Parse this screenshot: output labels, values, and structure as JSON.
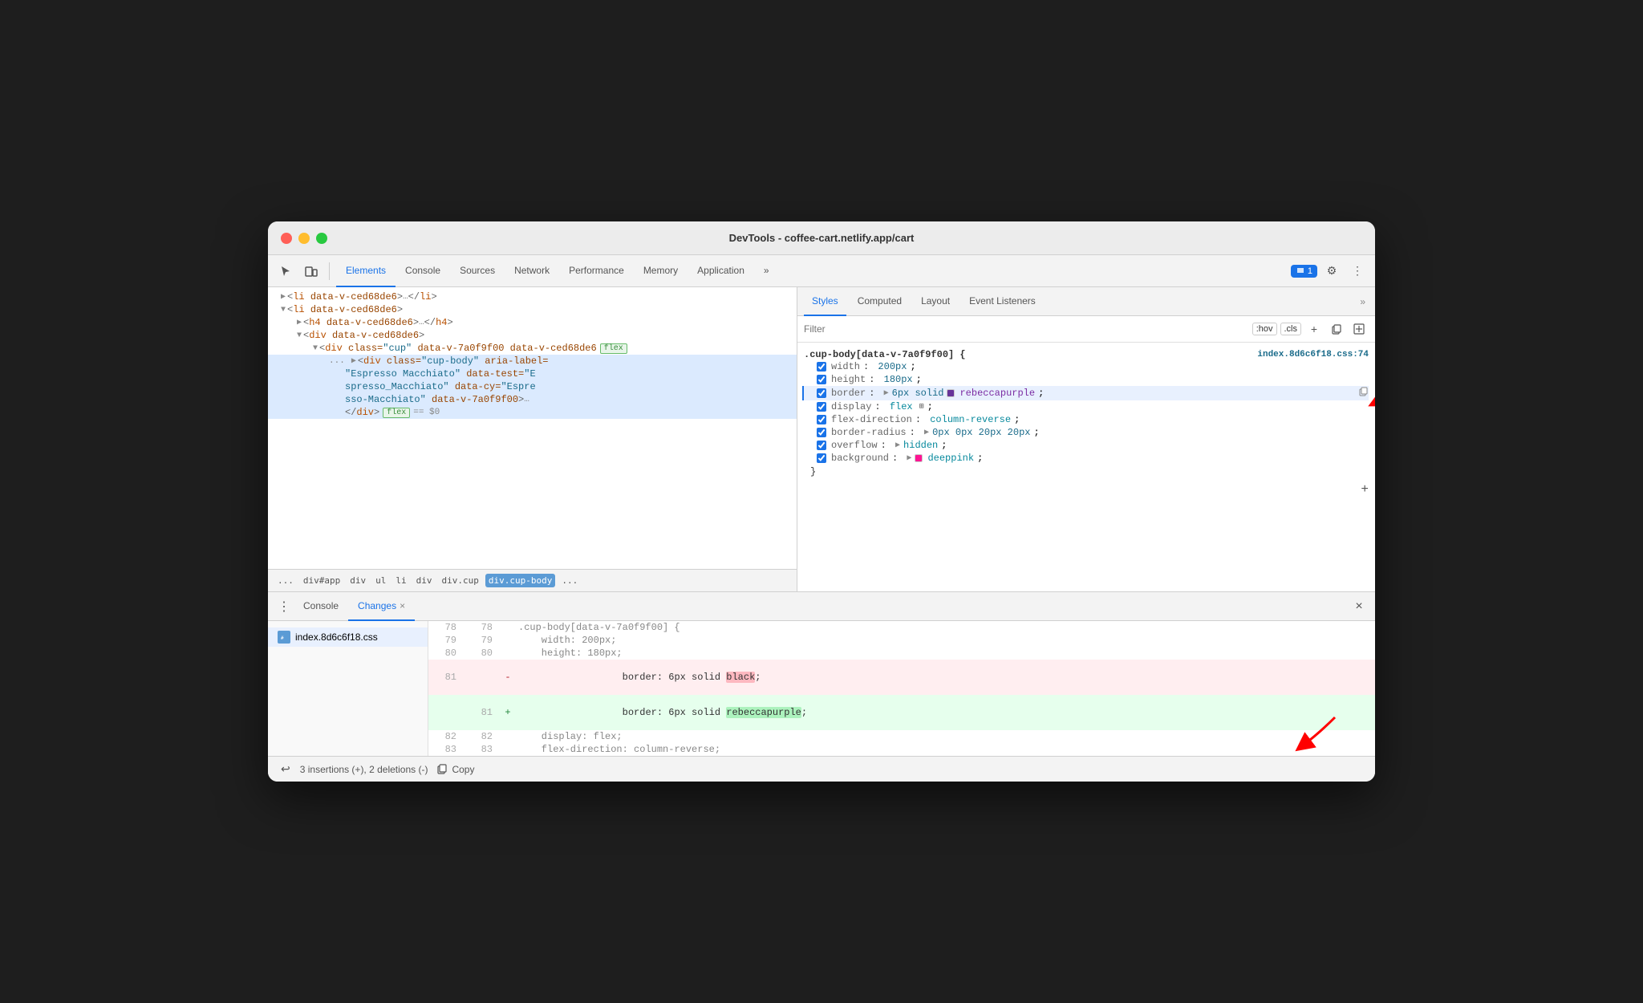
{
  "window": {
    "title": "DevTools - coffee-cart.netlify.app/cart"
  },
  "toolbar": {
    "tabs": [
      {
        "id": "elements",
        "label": "Elements",
        "active": true
      },
      {
        "id": "console",
        "label": "Console",
        "active": false
      },
      {
        "id": "sources",
        "label": "Sources",
        "active": false
      },
      {
        "id": "network",
        "label": "Network",
        "active": false
      },
      {
        "id": "performance",
        "label": "Performance",
        "active": false
      },
      {
        "id": "memory",
        "label": "Memory",
        "active": false
      },
      {
        "id": "application",
        "label": "Application",
        "active": false
      }
    ],
    "notification_count": "1",
    "more_label": "»"
  },
  "styles_panel": {
    "tabs": [
      {
        "id": "styles",
        "label": "Styles",
        "active": true
      },
      {
        "id": "computed",
        "label": "Computed"
      },
      {
        "id": "layout",
        "label": "Layout"
      },
      {
        "id": "event_listeners",
        "label": "Event Listeners"
      }
    ],
    "filter_placeholder": "Filter",
    "filter_badges": [
      ":hov",
      ".cls"
    ],
    "rule": {
      "selector": ".cup-body[data-v-7a0f9f00] {",
      "source": "index.8d6c6f18.css:74",
      "properties": [
        {
          "id": "width",
          "name": "width",
          "value": "200px",
          "checked": true,
          "highlighted": false
        },
        {
          "id": "height",
          "name": "height",
          "value": "180px",
          "checked": true,
          "highlighted": false
        },
        {
          "id": "border",
          "name": "border",
          "value": "6px solid",
          "color": "rebeccapurple",
          "color_hex": "#663399",
          "checked": true,
          "highlighted": true,
          "has_arrow": true
        },
        {
          "id": "display",
          "name": "display",
          "value": "flex",
          "checked": true,
          "highlighted": false
        },
        {
          "id": "flex-direction",
          "name": "flex-direction",
          "value": "column-reverse",
          "checked": true,
          "highlighted": false
        },
        {
          "id": "border-radius",
          "name": "border-radius",
          "value": "0px 0px 20px 20px",
          "checked": true,
          "highlighted": false,
          "has_arrow": true
        },
        {
          "id": "overflow",
          "name": "overflow",
          "value": "hidden",
          "checked": true,
          "highlighted": false,
          "has_arrow": true
        },
        {
          "id": "background",
          "name": "background",
          "value": "deeppink",
          "color_hex": "#ff1493",
          "checked": true,
          "highlighted": false,
          "has_arrow": true
        }
      ]
    }
  },
  "elements_panel": {
    "lines": [
      {
        "id": "l1",
        "indent": 0,
        "collapsed": true,
        "text": "<li data-v-ced68de6>…</li>"
      },
      {
        "id": "l2",
        "indent": 0,
        "expanded": true,
        "text": "<li data-v-ced68de6>"
      },
      {
        "id": "l3",
        "indent": 1,
        "collapsed": true,
        "text": "<h4 data-v-ced68de6>…</h4>"
      },
      {
        "id": "l4",
        "indent": 1,
        "expanded": true,
        "text": "<div data-v-ced68de6>"
      },
      {
        "id": "l5",
        "indent": 2,
        "expanded": true,
        "text": "<div class=\"cup\" data-v-7a0f9f00 data-v-ced68de6>",
        "badge": "flex"
      },
      {
        "id": "l6",
        "indent": 3,
        "text": "<div class=\"cup-body\" aria-label=\"Espresso Macchiato\" data-test=\"Espresso_Macchiato\" data-cy=\"Espresso-Macchiato\" data-v-7a0f9f00>…",
        "badge": "flex",
        "dollar_zero": true
      }
    ],
    "breadcrumb": [
      "...",
      "div#app",
      "div",
      "ul",
      "li",
      "div",
      "div.cup",
      "div.cup-body",
      "..."
    ]
  },
  "bottom_panel": {
    "tabs": [
      {
        "id": "console",
        "label": "Console"
      },
      {
        "id": "changes",
        "label": "Changes",
        "active": true,
        "closeable": true
      }
    ],
    "file_tree": [
      {
        "name": "index.8d6c6f18.css",
        "active": true
      }
    ],
    "diff": {
      "lines": [
        {
          "left_num": "78",
          "right_num": "78",
          "type": "normal",
          "text": ".cup-body[data-v-7a0f9f00] {",
          "indent": "    "
        },
        {
          "left_num": "79",
          "right_num": "79",
          "type": "normal",
          "text": "    width: 200px;",
          "indent": ""
        },
        {
          "left_num": "80",
          "right_num": "80",
          "type": "normal",
          "text": "    height: 180px;",
          "indent": ""
        },
        {
          "left_num": "81",
          "right_num": "",
          "type": "removed",
          "text_before": "    border: 6px solid ",
          "highlight": "black",
          "text_after": ";",
          "sign": "-"
        },
        {
          "left_num": "",
          "right_num": "81",
          "type": "added",
          "text_before": "    border: 6px solid ",
          "highlight": "rebeccapurple",
          "text_after": ";",
          "sign": "+"
        },
        {
          "left_num": "82",
          "right_num": "82",
          "type": "normal",
          "text": "    display: flex;",
          "indent": ""
        },
        {
          "left_num": "83",
          "right_num": "83",
          "type": "normal",
          "text": "    flex-direction: column-reverse;",
          "indent": ""
        }
      ],
      "footer": {
        "undo_label": "↩",
        "stats": "3 insertions (+), 2 deletions (-)",
        "copy_icon": "⧉",
        "copy_label": "Copy"
      }
    }
  },
  "colors": {
    "accent_blue": "#1a73e8",
    "tab_active_border": "#1a73e8",
    "rebeccapurple": "#663399",
    "deeppink": "#ff1493",
    "removed_bg": "#ffeef0",
    "added_bg": "#e6ffed",
    "highlight_removed": "#fdb8c0",
    "highlight_added": "#acf2bd"
  }
}
